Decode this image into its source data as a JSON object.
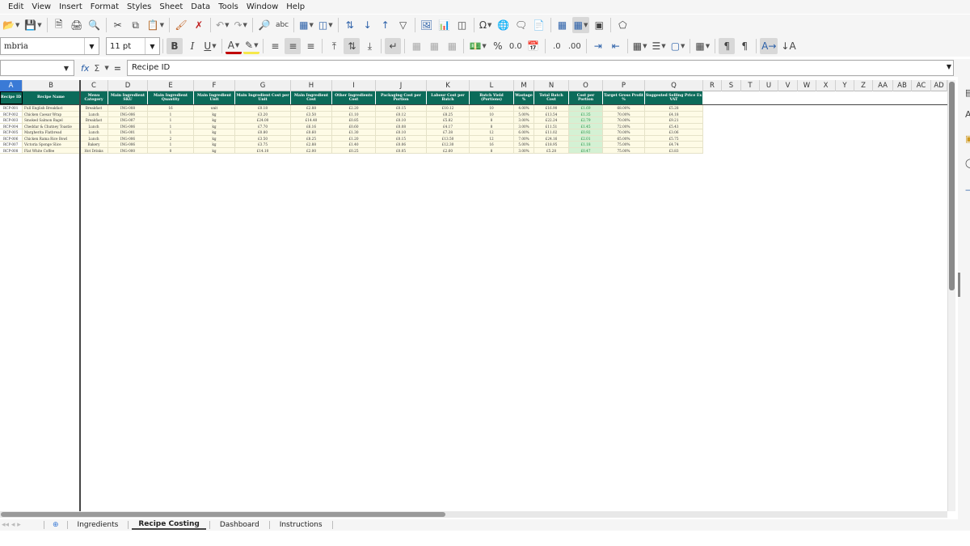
{
  "menu": [
    "Edit",
    "View",
    "Insert",
    "Format",
    "Styles",
    "Sheet",
    "Data",
    "Tools",
    "Window",
    "Help"
  ],
  "toolbar": {
    "font_name": "mbria",
    "font_size": "11 pt",
    "bold_label": "B",
    "italic_label": "I",
    "underline_label": "U",
    "percent_label": "%",
    "decimal_label": "0.0"
  },
  "formula_bar": {
    "name_box": "",
    "fx_label": "fx",
    "sum_label": "Σ",
    "equals_label": "=",
    "content": "Recipe ID"
  },
  "columns": [
    "A",
    "B",
    "C",
    "D",
    "E",
    "F",
    "G",
    "H",
    "I",
    "J",
    "K",
    "L",
    "M",
    "N",
    "O",
    "P",
    "Q",
    "R",
    "S",
    "T",
    "U",
    "V",
    "W",
    "X",
    "Y",
    "Z",
    "AA",
    "AB",
    "AC",
    "AD"
  ],
  "headers": [
    "Recipe ID",
    "Recipe Name",
    "Menu Category",
    "Main Ingredient SKU",
    "Main Ingredient Quantity",
    "Main Ingredient Unit",
    "Main Ingredient Cost per Unit",
    "Main Ingredient Cost",
    "Other Ingredients Cost",
    "Packaging Cost per Portion",
    "Labour Cost per Batch",
    "Batch Yield (Portions)",
    "Wastage %",
    "Total Batch Cost",
    "Cost per Portion",
    "Target Gross Profit %",
    "Suggested Selling Price Ex VAT"
  ],
  "rows": [
    [
      "RCP-001",
      "Full English Breakfast",
      "Breakfast",
      "ING-008",
      "16",
      "unit",
      "£0.18",
      "£2.88",
      "£2.20",
      "£0.15",
      "£10.12",
      "10",
      "4.00%",
      "£16.90",
      "£1.69",
      "68.00%",
      "£5.28"
    ],
    [
      "RCP-002",
      "Chicken Caesar Wrap",
      "Lunch",
      "ING-006",
      "1",
      "kg",
      "£3.20",
      "£3.50",
      "£1.10",
      "£0.12",
      "£8.25",
      "10",
      "5.00%",
      "£13.54",
      "£1.35",
      "70.00%",
      "£4.18"
    ],
    [
      "RCP-003",
      "Smoked Salmon Bagel",
      "Breakfast",
      "ING-007",
      "1",
      "kg",
      "£24.00",
      "£14.40",
      "£0.85",
      "£0.10",
      "£5.82",
      "8",
      "3.00%",
      "£22.24",
      "£2.79",
      "70.00%",
      "£9.21"
    ],
    [
      "RCP-004",
      "Cheddar & Chutney Toastie",
      "Lunch",
      "ING-006",
      "1",
      "kg",
      "£7.70",
      "£6.16",
      "£0.60",
      "£0.08",
      "£4.17",
      "8",
      "3.00%",
      "£11.51",
      "£1.45",
      "72.00%",
      "£5.43"
    ],
    [
      "RCP-005",
      "Margherita Flatbread",
      "Lunch",
      "ING-001",
      "1",
      "kg",
      "£0.80",
      "£0.60",
      "£1.30",
      "£0.10",
      "£7.38",
      "12",
      "6.00%",
      "£11.02",
      "£0.92",
      "70.00%",
      "£3.06"
    ],
    [
      "RCP-006",
      "Chicken Rama Rice Bowl",
      "Lunch",
      "ING-006",
      "2",
      "kg",
      "£3.50",
      "£8.25",
      "£1.20",
      "£0.15",
      "£13.50",
      "12",
      "7.00%",
      "£24.16",
      "£2.01",
      "65.00%",
      "£5.75"
    ],
    [
      "RCP-007",
      "Victoria Sponge Slice",
      "Bakery",
      "ING-006",
      "1",
      "kg",
      "£3.75",
      "£2.88",
      "£1.40",
      "£0.06",
      "£12.30",
      "16",
      "5.00%",
      "£18.95",
      "£1.18",
      "75.00%",
      "£4.74"
    ],
    [
      "RCP-008",
      "Flat White Coffee",
      "Hot Drinks",
      "ING-000",
      "0",
      "kg",
      "£14.10",
      "£2.00",
      "£0.25",
      "£0.05",
      "£2.60",
      "8",
      "3.00%",
      "£5.28",
      "£0.47",
      "75.00%",
      "£3.83"
    ]
  ],
  "sheet_tabs": [
    "Ingredients",
    "Recipe Costing",
    "Dashboard",
    "Instructions"
  ],
  "active_tab": "Recipe Costing",
  "colors": {
    "header_bg": "#0c6b5a",
    "row_bg": "#fefbe6",
    "highlight_bg": "#d4f1d4",
    "highlight_fg": "#1d8a3a",
    "selection": "#3a7ad6"
  }
}
